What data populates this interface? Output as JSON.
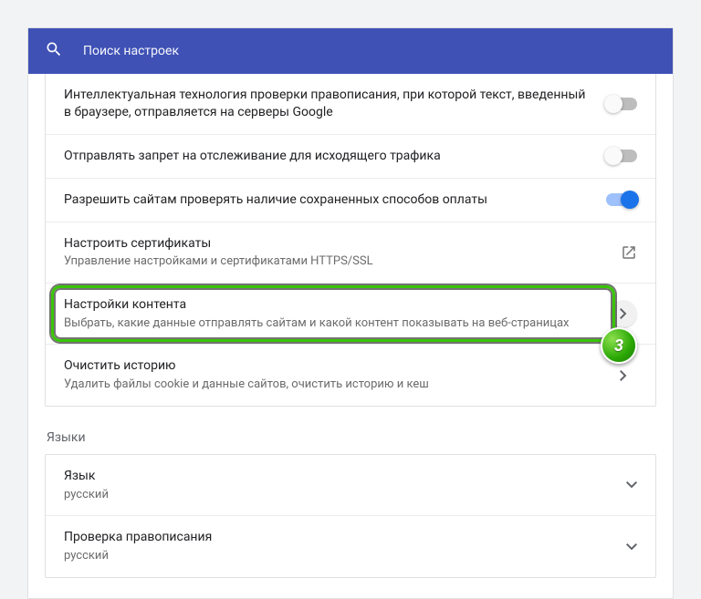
{
  "search": {
    "placeholder": "Поиск настроек"
  },
  "privacy": {
    "spellcheck": {
      "title": "Интеллектуальная технология проверки правописания, при которой текст, введенный в браузере, отправляется на серверы Google",
      "on": false
    },
    "dnt": {
      "title": "Отправлять запрет на отслеживание для исходящего трафика",
      "on": false
    },
    "payment": {
      "title": "Разрешить сайтам проверять наличие сохраненных способов оплаты",
      "on": true
    },
    "certs": {
      "title": "Настроить сертификаты",
      "sub": "Управление настройками и сертификатами HTTPS/SSL"
    },
    "content": {
      "title": "Настройки контента",
      "sub": "Выбрать, какие данные отправлять сайтам и какой контент показывать на веб-страницах"
    },
    "clear": {
      "title": "Очистить историю",
      "sub": "Удалить файлы cookie и данные сайтов, очистить историю и кеш"
    }
  },
  "sections": {
    "languages": "Языки"
  },
  "lang": {
    "language": {
      "title": "Язык",
      "value": "русский"
    },
    "spell": {
      "title": "Проверка правописания",
      "value": "русский"
    }
  },
  "annotation": {
    "step": "3"
  }
}
